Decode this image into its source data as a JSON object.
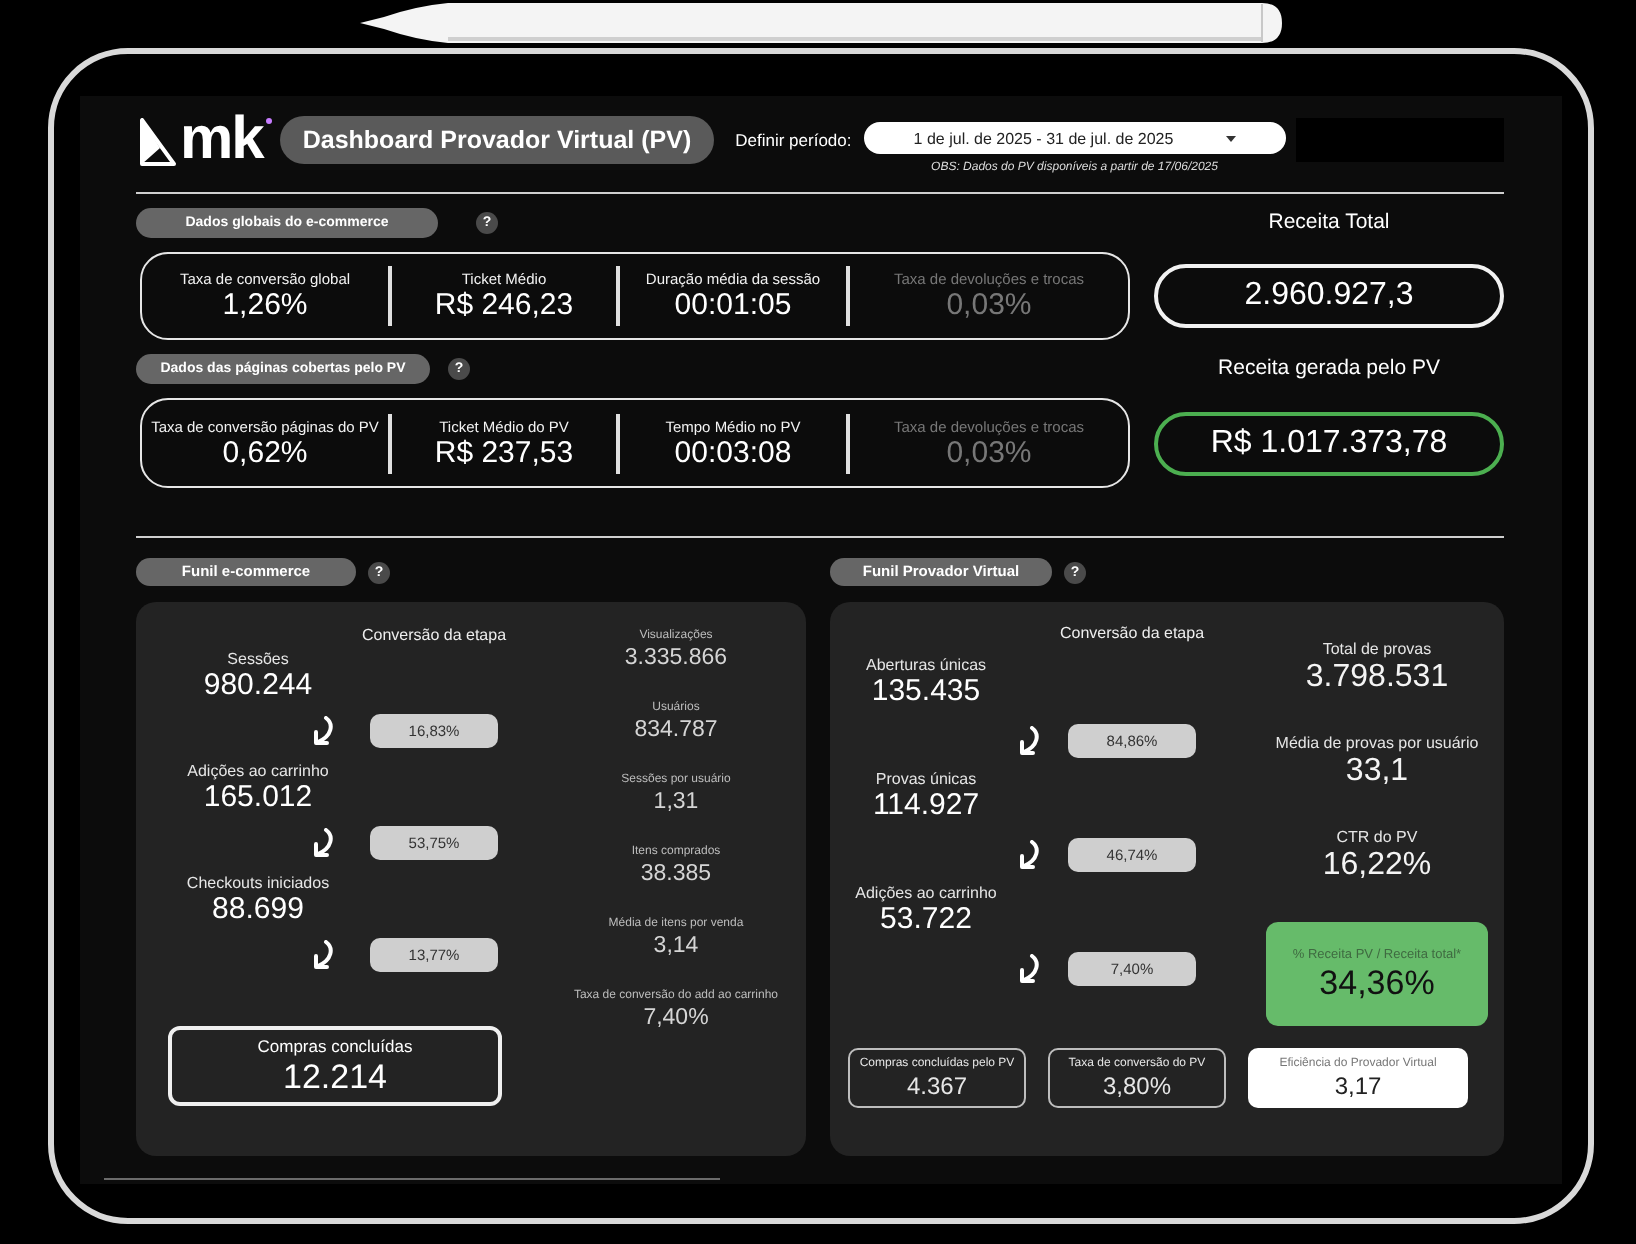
{
  "header": {
    "logo": "mk",
    "title": "Dashboard Provador Virtual (PV)",
    "period_label": "Definir período:",
    "period": "1 de jul. de 2025 - 31 de jul. de 2025",
    "note": "OBS: Dados do PV disponíveis a partir de 17/06/2025"
  },
  "kpi_sections": [
    {
      "title": "Dados globais do e-commerce",
      "help": "?",
      "metrics": [
        {
          "label": "Taxa de conversão global",
          "value": "1,26%",
          "disabled": false
        },
        {
          "label": "Ticket Médio",
          "value": "R$ 246,23",
          "disabled": false
        },
        {
          "label": "Duração média da sessão",
          "value": "00:01:05",
          "disabled": false
        },
        {
          "label": "Taxa de devoluções e trocas",
          "value": "0,03%",
          "disabled": true
        }
      ],
      "revenue": {
        "label": "Receita Total",
        "value": "2.960.927,3",
        "highlight": false
      }
    },
    {
      "title": "Dados das páginas cobertas pelo PV",
      "help": "?",
      "metrics": [
        {
          "label": "Taxa de conversão páginas do PV",
          "value": "0,62%",
          "disabled": false
        },
        {
          "label": "Ticket Médio do PV",
          "value": "R$ 237,53",
          "disabled": false
        },
        {
          "label": "Tempo Médio no PV",
          "value": "00:03:08",
          "disabled": false
        },
        {
          "label": "Taxa de devoluções e trocas",
          "value": "0,03%",
          "disabled": true
        }
      ],
      "revenue": {
        "label": "Receita gerada pelo PV",
        "value": "R$ 1.017.373,78",
        "highlight": true
      }
    }
  ],
  "funnels": [
    {
      "title": "Funil e-commerce",
      "help": "?",
      "heading": "Conversão da etapa",
      "steps": [
        {
          "label": "Sessões",
          "value": "980.244",
          "rate": "16,83%"
        },
        {
          "label": "Adições ao carrinho",
          "value": "165.012",
          "rate": "53,75%"
        },
        {
          "label": "Checkouts iniciados",
          "value": "88.699",
          "rate": "13,77%"
        }
      ],
      "final": {
        "label": "Compras concluídas",
        "value": "12.214"
      },
      "side_metrics": [
        {
          "kind": "small",
          "label": "Visualizações",
          "value": "3.335.866"
        },
        {
          "kind": "small",
          "label": "Usuários",
          "value": "834.787"
        },
        {
          "kind": "small",
          "label": "Sessões por usuário",
          "value": "1,31"
        },
        {
          "kind": "small",
          "label": "Itens comprados",
          "value": "38.385"
        },
        {
          "kind": "small",
          "label": "Média de itens por venda",
          "value": "3,14"
        },
        {
          "kind": "small",
          "label": "Taxa de conversão do add ao carrinho",
          "value": "7,40%"
        }
      ]
    },
    {
      "title": "Funil Provador Virtual",
      "help": "?",
      "heading": "Conversão da etapa",
      "steps": [
        {
          "label": "Aberturas únicas",
          "value": "135.435",
          "rate": "84,86%"
        },
        {
          "label": "Provas únicas",
          "value": "114.927",
          "rate": "46,74%"
        },
        {
          "label": "Adições ao carrinho",
          "value": "53.722",
          "rate": "7,40%"
        }
      ],
      "side_metrics": [
        {
          "kind": "large",
          "label": "Total de provas",
          "value": "3.798.531"
        },
        {
          "kind": "large",
          "label": "Média de provas por usuário",
          "value": "33,1"
        },
        {
          "kind": "large",
          "label": "CTR do PV",
          "value": "16,22%"
        },
        {
          "kind": "highlight",
          "label": "% Receita PV / Receita total*",
          "value": "34,36%"
        }
      ],
      "summary_cards": [
        {
          "kind": "outline",
          "label": "Compras concluídas pelo PV",
          "value": "4.367"
        },
        {
          "kind": "outline",
          "label": "Taxa de conversão do PV",
          "value": "3,80%"
        },
        {
          "kind": "filled",
          "label": "Eficiência do Provador Virtual",
          "value": "3,17"
        }
      ]
    }
  ]
}
